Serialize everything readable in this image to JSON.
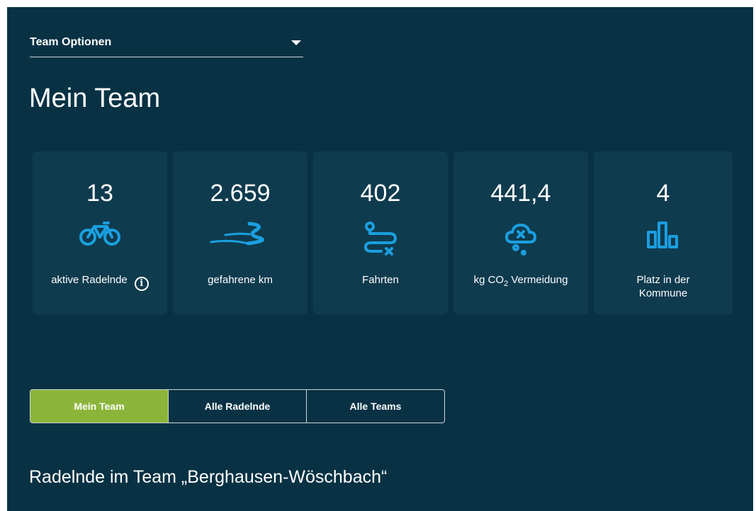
{
  "team_options": {
    "label": "Team Optionen",
    "caret_icon": "chevron-down-icon"
  },
  "title": "Mein Team",
  "stats": [
    {
      "value": "13",
      "label": "aktive Radelnde",
      "icon": "bicycle-icon",
      "info_icon": "info-icon"
    },
    {
      "value": "2.659",
      "label": "gefahrene km",
      "icon": "road-curve-icon"
    },
    {
      "value": "402",
      "label": "Fahrten",
      "icon": "route-icon"
    },
    {
      "value": "441,4",
      "label_pre": "kg CO",
      "label_sub": "2",
      "label_post": " Vermeidung",
      "icon": "cloud-co2-icon"
    },
    {
      "value": "4",
      "label_line1": "Platz in der",
      "label_line2": "Kommune",
      "icon": "bar-ranking-icon"
    }
  ],
  "tabs": [
    {
      "label": "Mein Team",
      "active": true
    },
    {
      "label": "Alle Radelnde",
      "active": false
    },
    {
      "label": "Alle Teams",
      "active": false
    }
  ],
  "section_title": "Radelnde im Team „Berghausen-Wöschbach“",
  "colors": {
    "background": "#083244",
    "card": "#0f3b4e",
    "accent_icon": "#1b9fe0",
    "active_tab": "#8bb53a"
  }
}
